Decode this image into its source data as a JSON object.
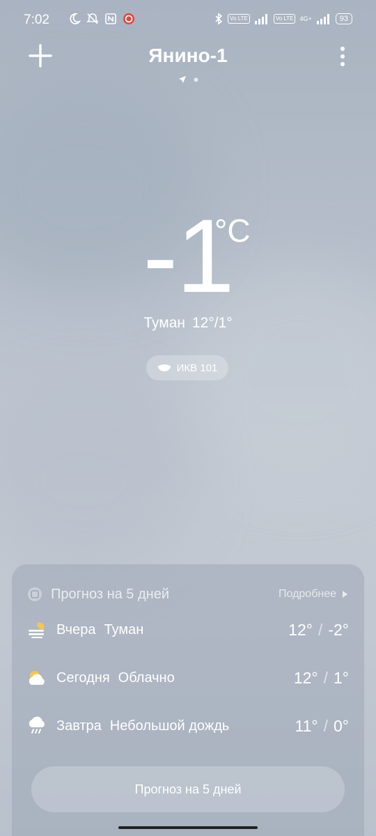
{
  "status_bar": {
    "time": "7:02",
    "battery": "93",
    "volte1": "Vo LTE",
    "volte2": "Vo LTE",
    "net": "4G+"
  },
  "header": {
    "city": "Янино-1",
    "add_icon": "plus-icon",
    "more_icon": "more-vertical-icon"
  },
  "current": {
    "temperature": "-1",
    "unit": "°C",
    "condition": "Туман",
    "high_low": "12°/1°",
    "aqi_label": "ИКВ 101"
  },
  "forecast": {
    "title": "Прогноз на 5 дней",
    "more": "Подробнее",
    "days": [
      {
        "day": "Вчера",
        "condition": "Туман",
        "high": "12°",
        "low": "-2°",
        "icon": "fog-icon"
      },
      {
        "day": "Сегодня",
        "condition": "Облачно",
        "high": "12°",
        "low": "1°",
        "icon": "cloudy-icon"
      },
      {
        "day": "Завтра",
        "condition": "Небольшой дождь",
        "high": "11°",
        "low": "0°",
        "icon": "light-rain-icon"
      }
    ],
    "button": "Прогноз на 5 дней"
  },
  "sep": "/"
}
